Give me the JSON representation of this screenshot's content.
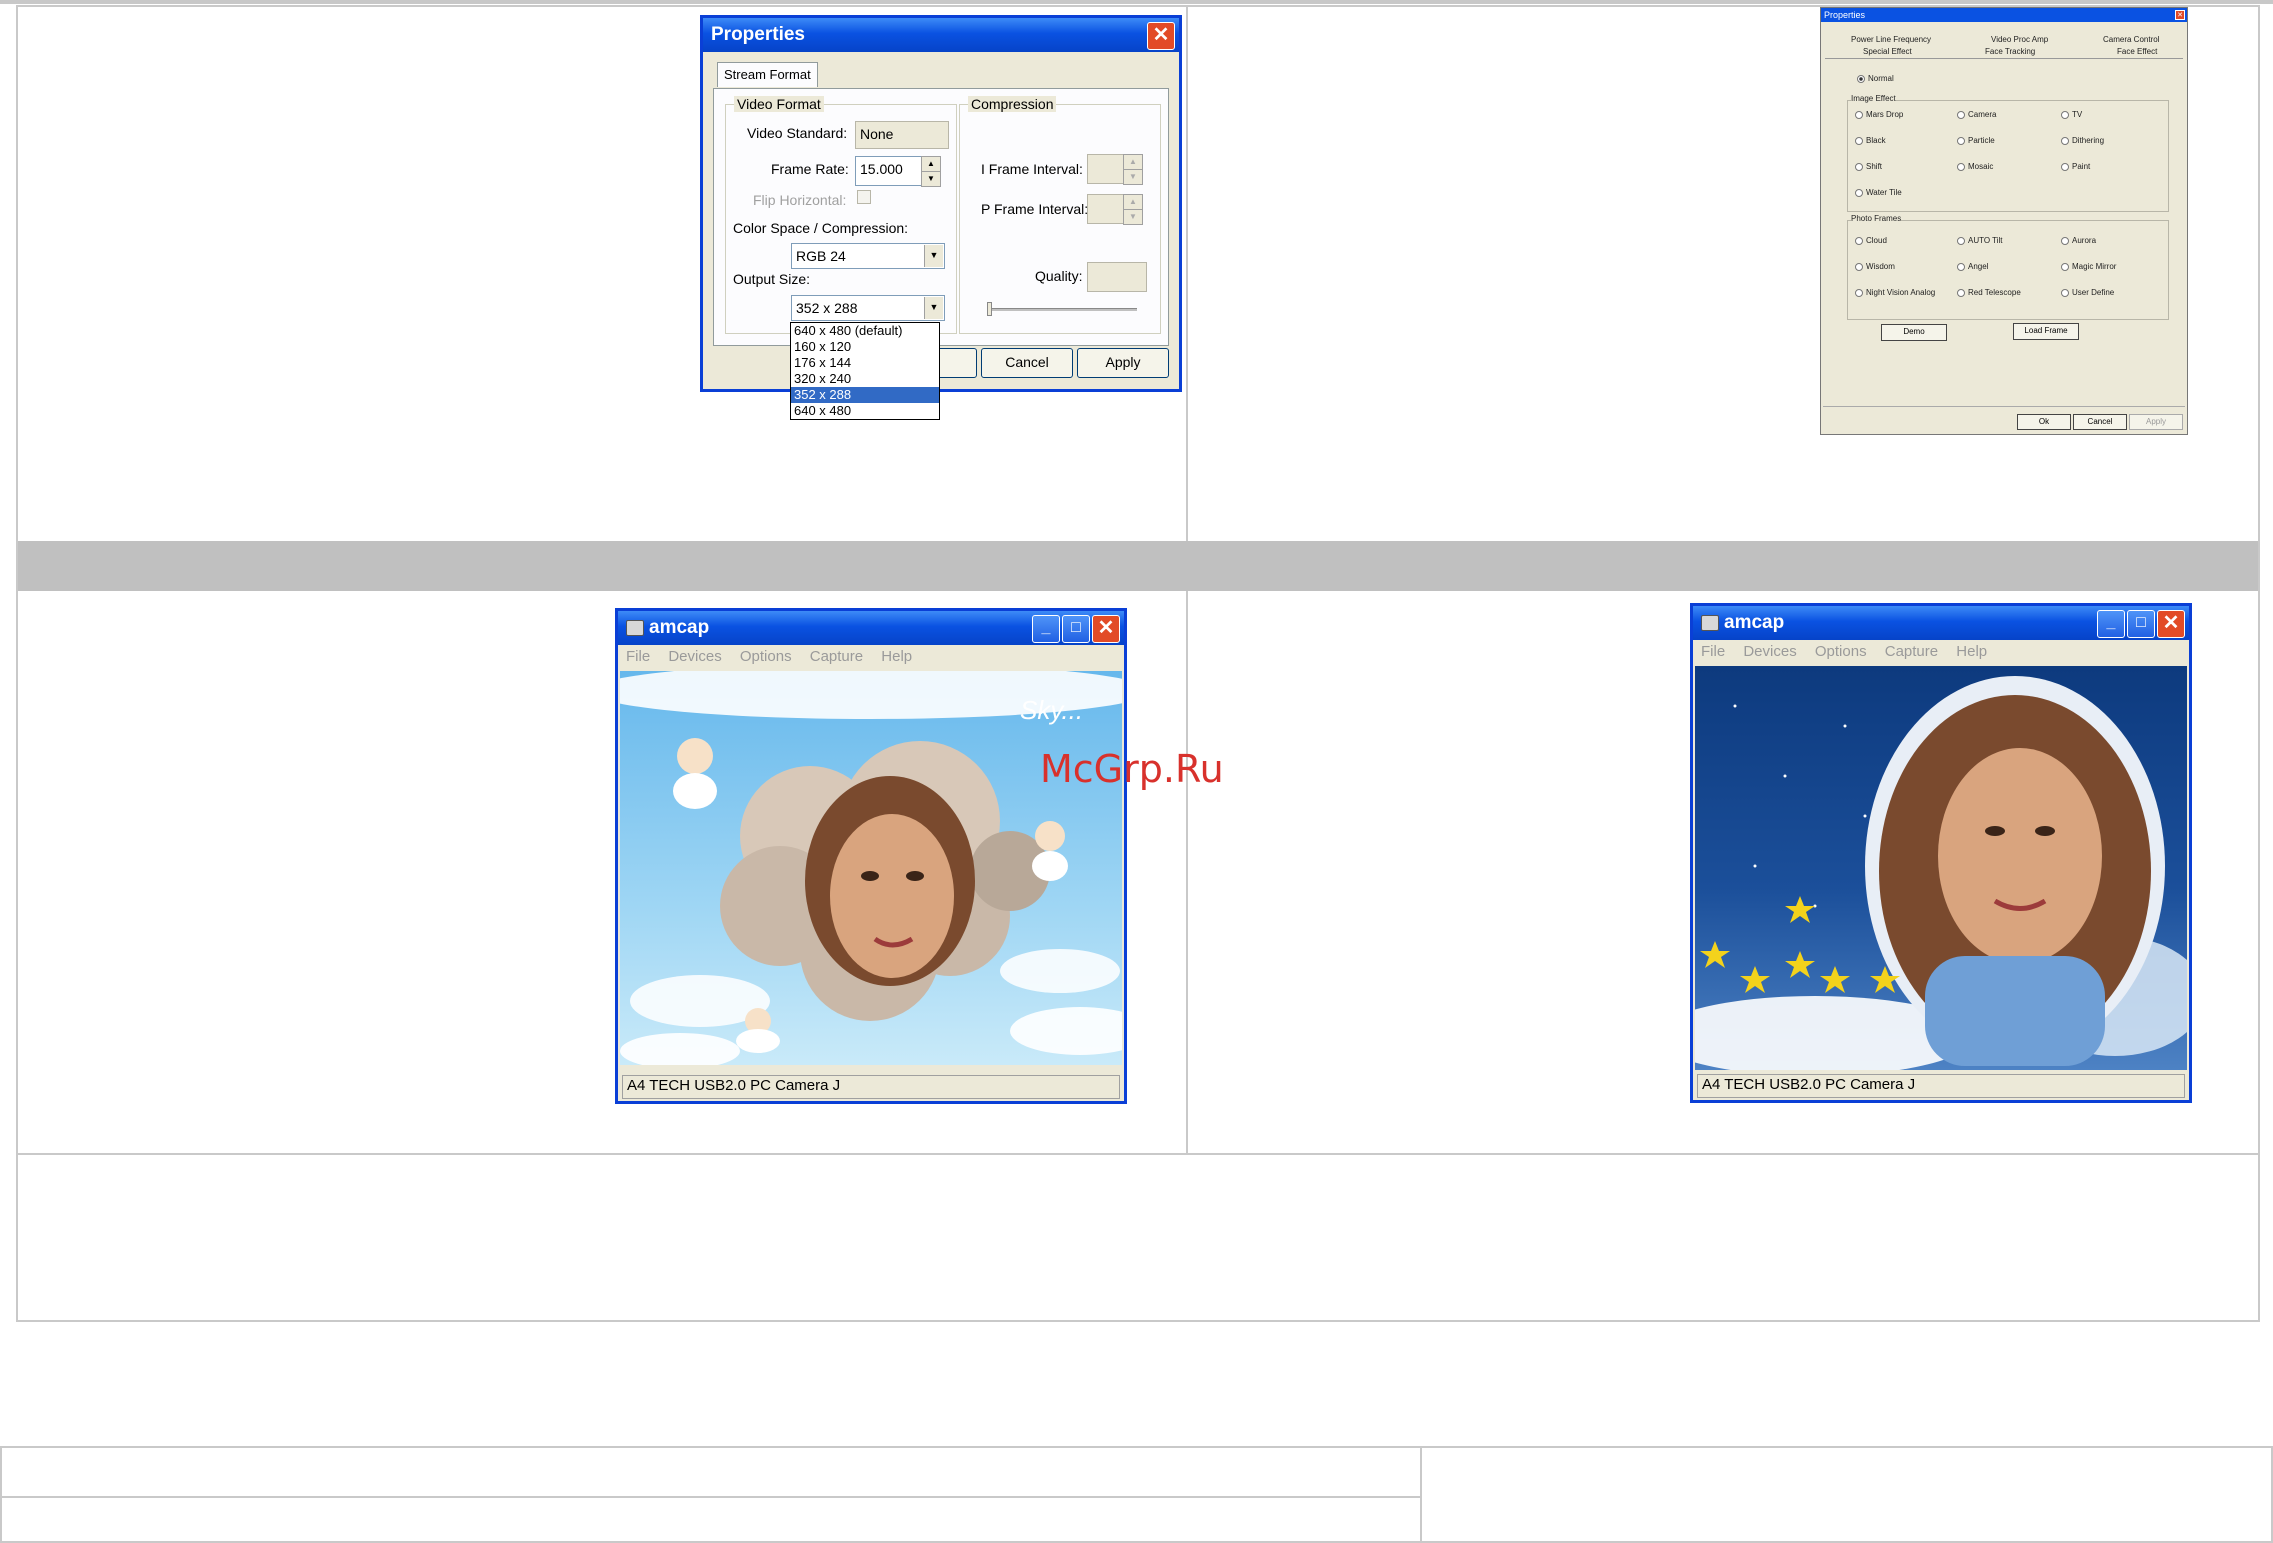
{
  "properties_dialog": {
    "title": "Properties",
    "close_glyph": "✕",
    "tab": "Stream Format",
    "video_format_group": "Video Format",
    "video_standard_label": "Video Standard:",
    "video_standard_value": "None",
    "frame_rate_label": "Frame Rate:",
    "frame_rate_value": "15.000",
    "flip_horizontal_label": "Flip Horizontal:",
    "color_space_label": "Color Space / Compression:",
    "color_space_value": "RGB 24",
    "output_size_label": "Output Size:",
    "output_size_value": "352 x 288",
    "output_size_options": [
      "640 x 480  (default)",
      "160 x 120",
      "176 x 144",
      "320 x 240",
      "352 x 288",
      "640 x 480"
    ],
    "output_size_selected_index": 4,
    "compression_group": "Compression",
    "i_frame_label": "I Frame Interval:",
    "p_frame_label": "P Frame Interval:",
    "quality_label": "Quality:",
    "cancel_label": "Cancel",
    "apply_label": "Apply"
  },
  "effects_dialog": {
    "title": "Properties",
    "tabs_row1": [
      "Power Line Frequency",
      "Video Proc Amp",
      "Camera Control"
    ],
    "tabs_row2": [
      "Special Effect",
      "Face Tracking",
      "Face Effect"
    ],
    "normal_label": "Normal",
    "image_effect_group": "Image Effect",
    "image_effects": [
      "Mars Drop",
      "Camera",
      "TV",
      "Black",
      "Particle",
      "Dithering",
      "Shift",
      "Mosaic",
      "Paint",
      "Water Tile"
    ],
    "photo_frames_group": "Photo Frames",
    "photo_frames": [
      "Cloud",
      "AUTO Tilt",
      "Aurora",
      "Wisdom",
      "Angel",
      "Magic Mirror",
      "Night Vision Analog",
      "Red Telescope",
      "User Define"
    ],
    "demo_button": "Demo",
    "load_frame_button": "Load Frame",
    "ok_button": "Ok",
    "cancel_button": "Cancel",
    "apply_button": "Apply"
  },
  "amcap_left": {
    "title": "amcap",
    "menu": [
      "File",
      "Devices",
      "Options",
      "Capture",
      "Help"
    ],
    "status": "A4 TECH USB2.0 PC Camera J",
    "sky_text": "Sky..."
  },
  "amcap_right": {
    "title": "amcap",
    "menu": [
      "File",
      "Devices",
      "Options",
      "Capture",
      "Help"
    ],
    "status": "A4 TECH USB2.0 PC Camera J"
  },
  "watermark": "McGrp.Ru",
  "colors": {
    "xp_title_blue": "#0a52e2",
    "selection_blue": "#316ac5",
    "sky_blue": "#8fcdf0",
    "night_blue": "#1b4f9a",
    "watermark_red": "#d8312c"
  }
}
